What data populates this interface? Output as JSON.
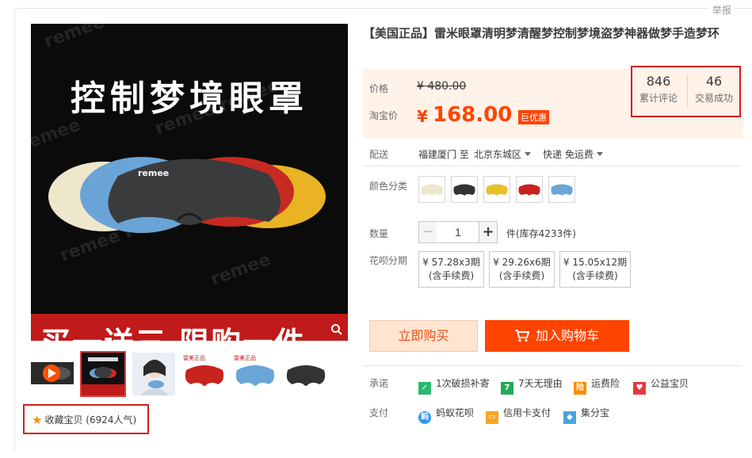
{
  "report_label": "举报",
  "gallery": {
    "headline": "控制梦境眼罩",
    "banner": "买一送三 限购一件",
    "brand_mark": "remee"
  },
  "favorite": {
    "label": "收藏宝贝 (6924人气)"
  },
  "product": {
    "title": "【美国正品】雷米眼罩清明梦清醒梦控制梦境盗梦神器做梦手造梦环"
  },
  "price": {
    "label": "价格",
    "original": "¥ 480.00",
    "taobao_label": "淘宝价",
    "currency": "¥",
    "current": "168.00",
    "tag": "巨优惠"
  },
  "stats": {
    "reviews_count": "846",
    "reviews_label": "累计评论",
    "sales_count": "46",
    "sales_label": "交易成功"
  },
  "shipping": {
    "label": "配送",
    "from": "福建厦门 至",
    "to": "北京东城区",
    "method": "快递 免运费"
  },
  "color": {
    "label": "颜色分类",
    "swatch_colors": [
      "#ece6cc",
      "#333333",
      "#e8c02a",
      "#c8231e",
      "#6aa6d8"
    ]
  },
  "quantity": {
    "label": "数量",
    "minus": "−",
    "value": "1",
    "plus": "+",
    "stock": "件(库存4233件)"
  },
  "installment": {
    "label": "花呗分期",
    "options": [
      {
        "price": "¥ 57.28x3期",
        "fee": "(含手续费)"
      },
      {
        "price": "¥ 29.26x6期",
        "fee": "(含手续费)"
      },
      {
        "price": "¥ 15.05x12期",
        "fee": "(含手续费)"
      }
    ]
  },
  "actions": {
    "buy_now": "立即购买",
    "add_to_cart": "加入购物车"
  },
  "promise": {
    "label": "承诺",
    "items": [
      {
        "icon": "shield-icon",
        "text": "1次破损补寄",
        "color": "#2db86e"
      },
      {
        "icon": "seven-days-icon",
        "text": "7天无理由",
        "color": "#22aa55"
      },
      {
        "icon": "freight-insurance-icon",
        "text": "运费险",
        "color": "#ff8a00"
      },
      {
        "icon": "charity-icon",
        "text": "公益宝贝",
        "color": "#e4393c"
      }
    ]
  },
  "payment": {
    "label": "支付",
    "items": [
      {
        "icon": "ant-huabei-icon",
        "text": "蚂蚁花呗",
        "color": "#2b9bf0"
      },
      {
        "icon": "credit-card-icon",
        "text": "信用卡支付",
        "color": "#f5a623"
      },
      {
        "icon": "jifenbao-icon",
        "text": "集分宝",
        "color": "#4aa3df"
      }
    ]
  }
}
